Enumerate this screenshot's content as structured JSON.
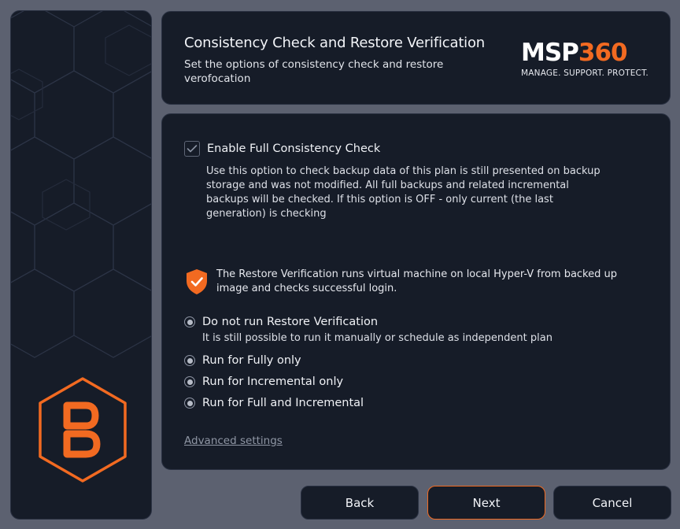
{
  "header": {
    "title": "Consistency Check and Restore Verification",
    "subtitle": "Set the options of consistency check and restore verofocation"
  },
  "logo": {
    "msp": "MSP",
    "num": "360",
    "tagline": "MANAGE. SUPPORT. PROTECT."
  },
  "consistency": {
    "checkbox_label": "Enable Full Consistency Check",
    "checked": true,
    "description": "Use this option to check backup data of this plan is still presented on backup storage and was not modified. All full backups and related incremental backups will be checked. If this option is OFF - only current (the last generation) is checking"
  },
  "verification": {
    "info": "The Restore Verification runs virtual machine on local Hyper-V from backed up image and checks successful login.",
    "options": [
      {
        "label": "Do not run Restore Verification"
      },
      {
        "label": "Run for Fully only"
      },
      {
        "label": "Run for Incremental only"
      },
      {
        "label": "Run for Full and Incremental"
      }
    ],
    "hint": "It is still possible to run it manually or schedule as independent plan"
  },
  "advanced_link": "Advanced settings",
  "buttons": {
    "back": "Back",
    "next": "Next",
    "cancel": "Cancel"
  },
  "colors": {
    "accent": "#f26a21",
    "panel": "#161c28",
    "background": "#5c6170"
  },
  "icons": {
    "brand": "hexagon-b-logo-icon",
    "shield": "shield-check-icon",
    "checkbox": "check-icon"
  }
}
